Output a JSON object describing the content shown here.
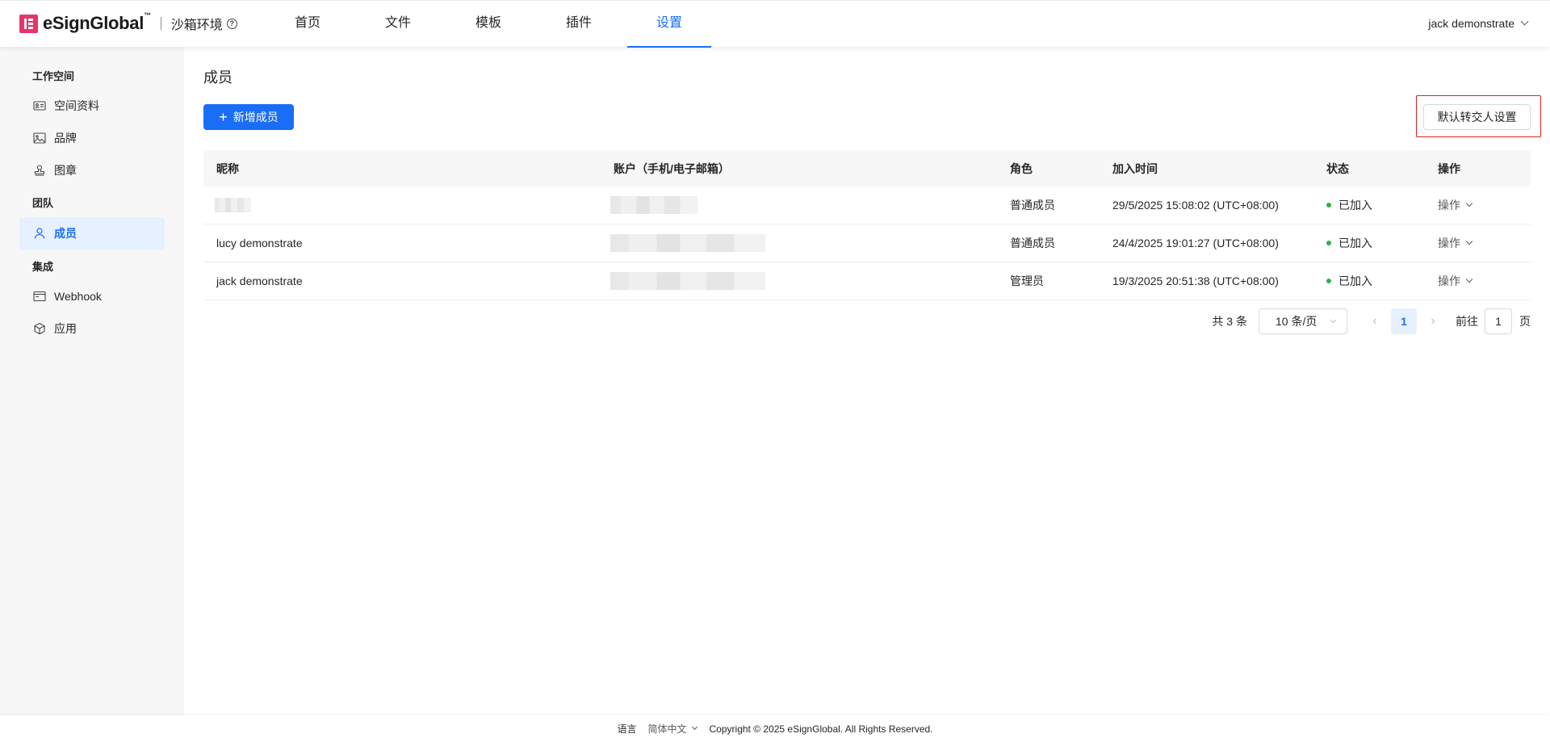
{
  "header": {
    "brand": "eSignGlobal",
    "brand_tm": "™",
    "env_label": "沙箱环境",
    "nav": [
      "首页",
      "文件",
      "模板",
      "插件",
      "设置"
    ],
    "active_nav": "设置",
    "user_name": "jack demonstrate"
  },
  "sidebar": {
    "group_workspace": "工作空间",
    "item_space_info": "空间资料",
    "item_brand": "品牌",
    "item_seal": "图章",
    "group_team": "团队",
    "item_members": "成员",
    "group_integration": "集成",
    "item_webhook": "Webhook",
    "item_apps": "应用"
  },
  "main": {
    "title": "成员",
    "add_member_button": "新增成员",
    "default_transfer_button": "默认转交人设置"
  },
  "table": {
    "columns": [
      "昵称",
      "账户（手机/电子邮箱）",
      "角色",
      "加入时间",
      "状态",
      "操作"
    ],
    "rows": [
      {
        "nickname": "",
        "account": "",
        "role": "普通成员",
        "joined": "29/5/2025 15:08:02 (UTC+08:00)",
        "status": "已加入",
        "action": "操作"
      },
      {
        "nickname": "lucy demonstrate",
        "account": "",
        "role": "普通成员",
        "joined": "24/4/2025 19:01:27 (UTC+08:00)",
        "status": "已加入",
        "action": "操作"
      },
      {
        "nickname": "jack demonstrate",
        "account": "",
        "role": "管理员",
        "joined": "19/3/2025 20:51:38 (UTC+08:00)",
        "status": "已加入",
        "action": "操作"
      }
    ]
  },
  "pagination": {
    "total": "共 3 条",
    "page_size": "10 条/页",
    "current_page": "1",
    "jump_label": "前往",
    "jump_value": "1",
    "page_suffix": "页"
  },
  "footer": {
    "language_label": "语言",
    "language_value": "简体中文",
    "copyright": "Copyright © 2025 eSignGlobal. All Rights Reserved."
  },
  "colors": {
    "primary": "#1a6ef6",
    "status_active": "#2db44a",
    "highlight_border": "#e0211c",
    "logo": "#e8356a"
  }
}
